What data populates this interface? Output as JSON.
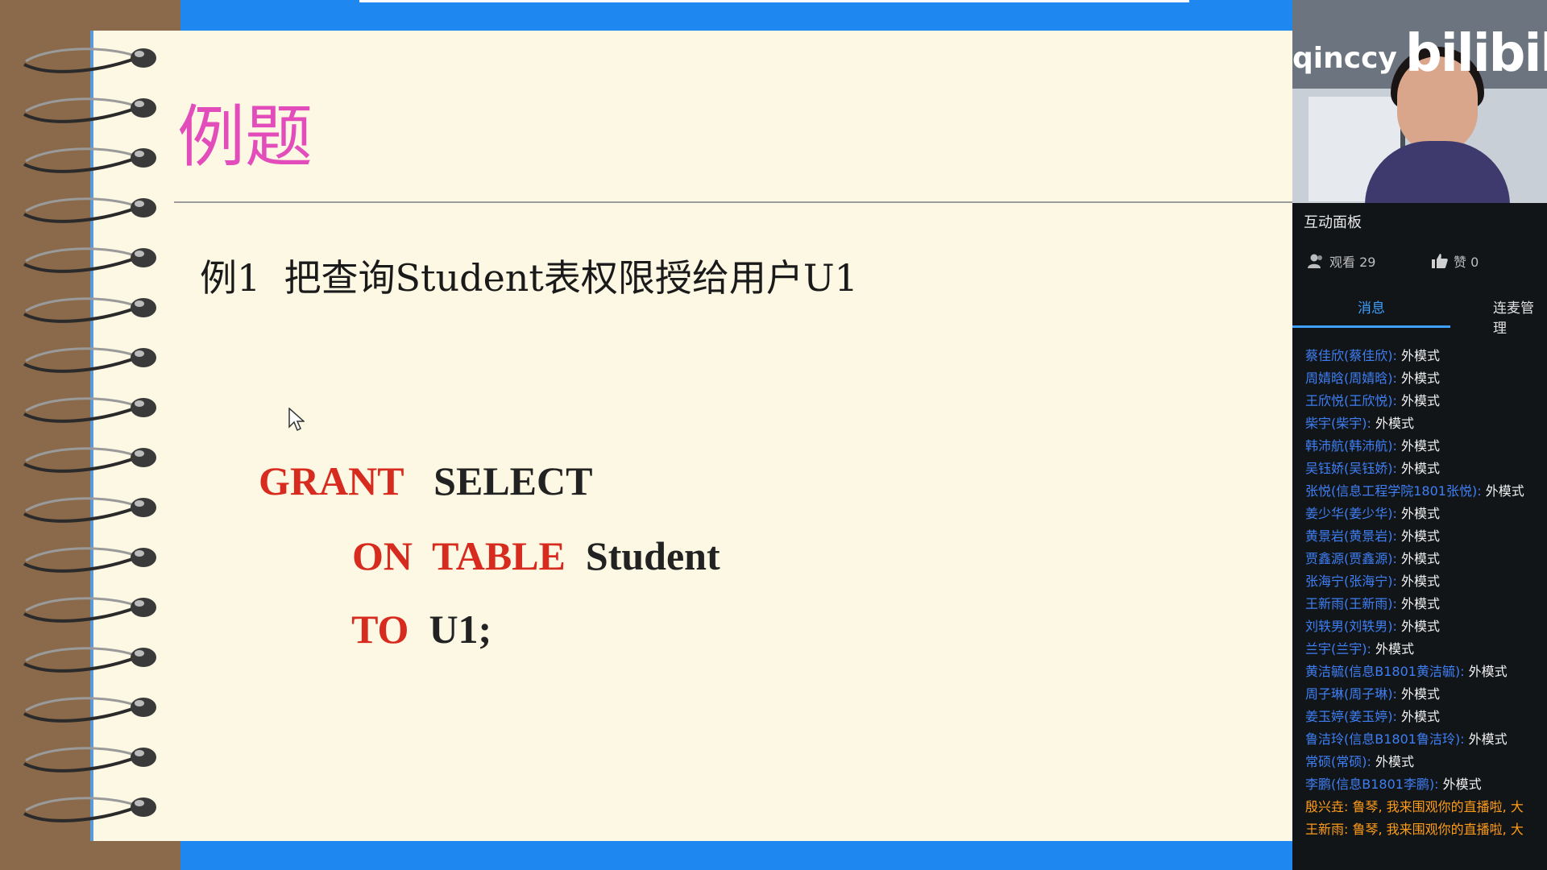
{
  "slide": {
    "title": "例题",
    "example": "例1  把查询Student表权限授给用户U1",
    "sql": {
      "line1": {
        "kw": "GRANT",
        "ident": "SELECT"
      },
      "line2": {
        "kw1": "ON",
        "kw2": "TABLE",
        "ident": "Student"
      },
      "line3": {
        "kw": "TO",
        "ident": "U1;"
      }
    }
  },
  "webcam": {
    "watermark_user": "qinccy",
    "watermark_logo": "bilibili"
  },
  "panel": {
    "title": "互动面板",
    "viewers_label": "观看 29",
    "likes_label": "赞 0",
    "tabs": [
      "消息",
      "连麦管理"
    ],
    "messages": [
      {
        "user": "蔡佳欣(蔡佳欣):",
        "text": "外模式"
      },
      {
        "user": "周婧晗(周婧晗):",
        "text": "外模式"
      },
      {
        "user": "王欣悦(王欣悦):",
        "text": "外模式"
      },
      {
        "user": "柴宇(柴宇):",
        "text": "外模式"
      },
      {
        "user": "韩沛航(韩沛航):",
        "text": "外模式"
      },
      {
        "user": "吴钰娇(吴钰娇):",
        "text": "外模式"
      },
      {
        "user": "张悦(信息工程学院1801张悦):",
        "text": "外模式"
      },
      {
        "user": "姜少华(姜少华):",
        "text": "外模式"
      },
      {
        "user": "黄景岩(黄景岩):",
        "text": "外模式"
      },
      {
        "user": "贾鑫源(贾鑫源):",
        "text": "外模式"
      },
      {
        "user": "张海宁(张海宁):",
        "text": "外模式"
      },
      {
        "user": "王新雨(王新雨):",
        "text": "外模式"
      },
      {
        "user": "刘轶男(刘轶男):",
        "text": "外模式"
      },
      {
        "user": "兰宇(兰宇):",
        "text": "外模式"
      },
      {
        "user": "黄洁毓(信息B1801黄洁毓):",
        "text": "外模式"
      },
      {
        "user": "周子琳(周子琳):",
        "text": "外模式"
      },
      {
        "user": "姜玉婷(姜玉婷):",
        "text": "外模式"
      },
      {
        "user": "鲁洁玲(信息B1801鲁洁玲):",
        "text": "外模式"
      },
      {
        "user": "常硕(常硕):",
        "text": "外模式"
      },
      {
        "user": "李鹏(信息B1801李鹏):",
        "text": "外模式"
      },
      {
        "user": "殷兴垚:",
        "text": "鲁琴, 我来围观你的直播啦, 大"
      },
      {
        "user": "王新雨:",
        "text": "鲁琴, 我来围观你的直播啦, 大"
      }
    ]
  },
  "colors": {
    "keyword": "#d62b1e",
    "title": "#e34dbb",
    "username": "#3e7ff5",
    "highlight": "#ff9d1a",
    "accent": "#3ea0ff",
    "frame_blue": "#1e88f0"
  }
}
